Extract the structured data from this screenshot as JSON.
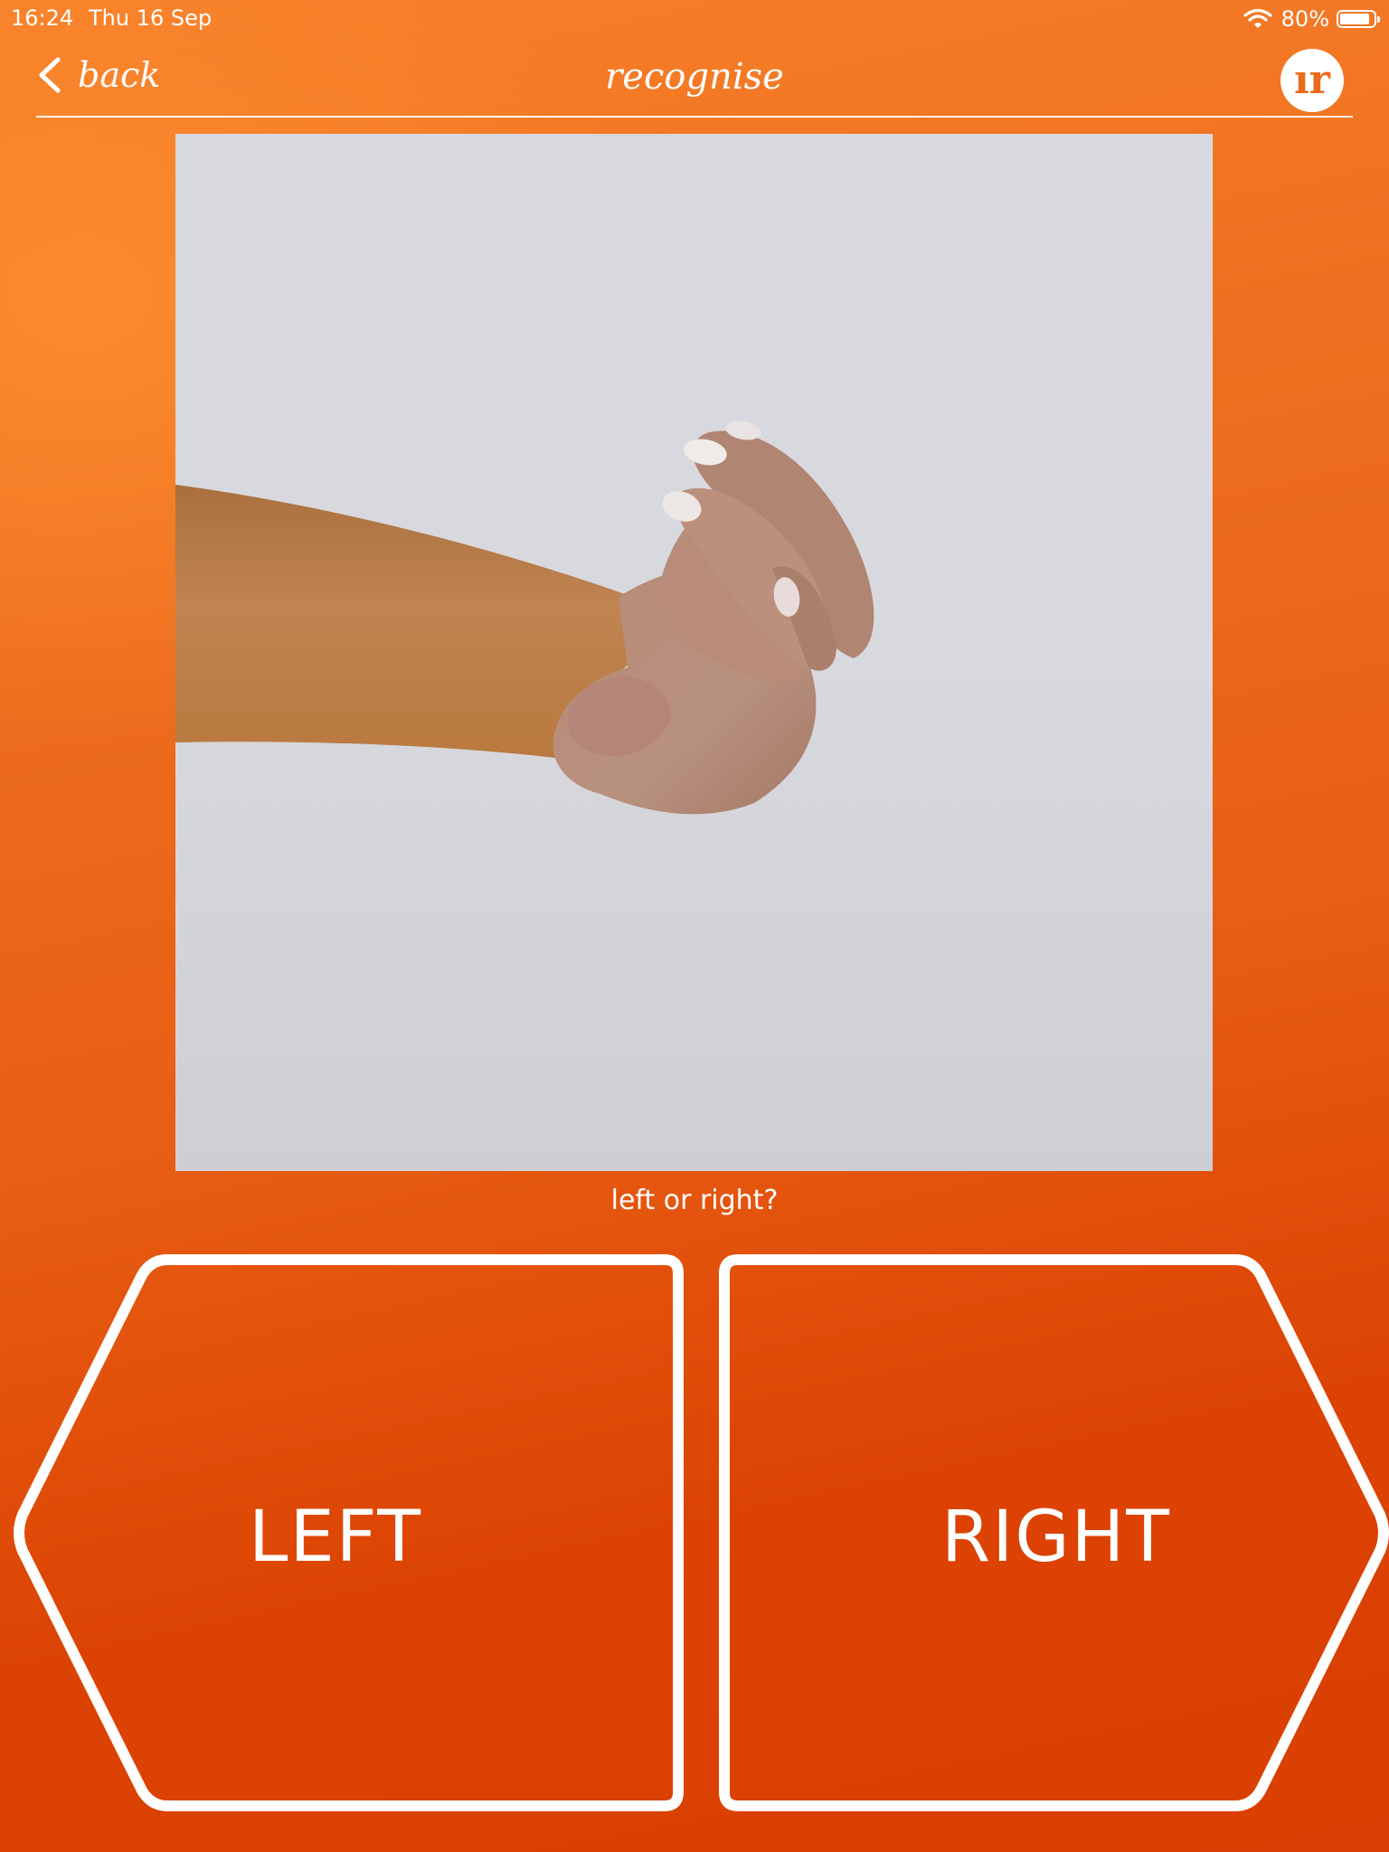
{
  "status_bar": {
    "time": "16:24",
    "date": "Thu 16 Sep",
    "battery_percent": "80%",
    "battery_level": 0.8,
    "icons": [
      "wifi-icon",
      "battery-icon"
    ]
  },
  "nav": {
    "back_label": "back",
    "title": "recognise",
    "logo_text": "ır"
  },
  "image": {
    "subject": "hand-photo",
    "background_color": "#d7d9df"
  },
  "question": "left or right?",
  "answers": {
    "left_label": "LEFT",
    "right_label": "RIGHT"
  },
  "colors": {
    "background_top": "#f8802a",
    "background_bottom": "#d93f02",
    "outline": "#ffffff",
    "logo_accent": "#ec6a1c"
  }
}
